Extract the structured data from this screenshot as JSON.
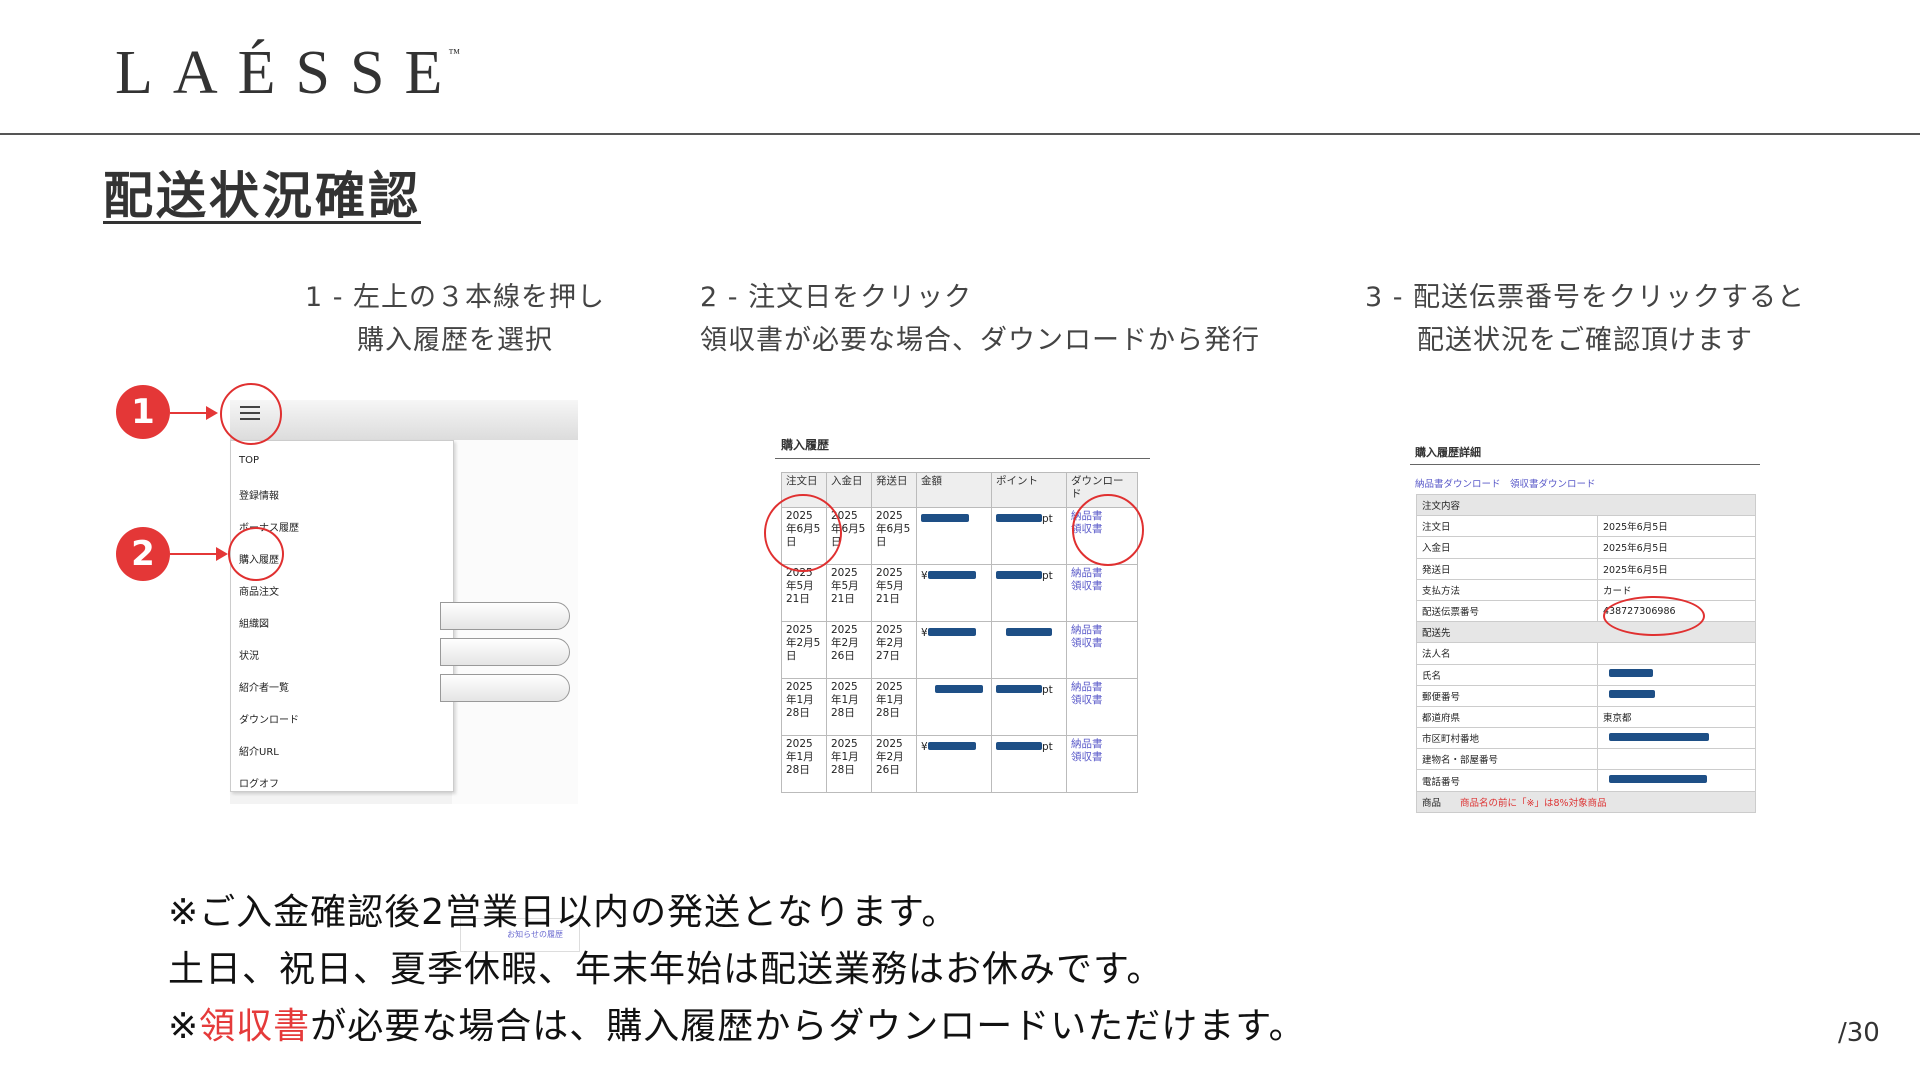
{
  "logo": {
    "brand": "LAÉSSE",
    "tm": "™"
  },
  "page_title": "配送状況確認",
  "steps": [
    {
      "line1": "1 - 左上の３本線を押し",
      "line2": "購入履歴を選択"
    },
    {
      "line1": "2 - 注文日をクリック",
      "line2": "領収書が必要な場合、ダウンロードから発行"
    },
    {
      "line1": "3 - 配送伝票番号をクリックすると",
      "line2": "配送状況をご確認頂けます"
    }
  ],
  "screen1": {
    "badges": [
      "1",
      "2"
    ],
    "menu_items": [
      "TOP",
      "登録情報",
      "ボーナス履歴",
      "購入履歴",
      "商品注文",
      "組織図",
      "状況",
      "紹介者一覧",
      "ダウンロード",
      "紹介URL",
      "ログオフ"
    ],
    "notice_link": "お知らせの履歴"
  },
  "screen2": {
    "title": "購入履歴",
    "headers": [
      "注文日",
      "入金日",
      "発送日",
      "金額",
      "ポイント",
      "ダウンロード"
    ],
    "rows": [
      {
        "order": "2025年6月5日",
        "paid": "2025年6月5日",
        "ship": "2025年6月5日",
        "amount_prefix": "",
        "point_suffix": "pt"
      },
      {
        "order": "2025年5月21日",
        "paid": "2025年5月21日",
        "ship": "2025年5月21日",
        "amount_prefix": "¥",
        "point_suffix": "pt"
      },
      {
        "order": "2025年2月5日",
        "paid": "2025年2月26日",
        "ship": "2025年2月27日",
        "amount_prefix": "¥",
        "point_suffix": ""
      },
      {
        "order": "2025年1月28日",
        "paid": "2025年1月28日",
        "ship": "2025年1月28日",
        "amount_prefix": "",
        "point_suffix": "pt"
      },
      {
        "order": "2025年1月28日",
        "paid": "2025年1月28日",
        "ship": "2025年2月26日",
        "amount_prefix": "¥",
        "point_suffix": "pt"
      }
    ],
    "dl_invoice": "納品書",
    "dl_receipt": "領収書"
  },
  "screen3": {
    "title": "購入履歴詳細",
    "links": "納品書ダウンロード　領収書ダウンロード",
    "section_order": "注文内容",
    "order_rows": [
      {
        "k": "注文日",
        "v": "2025年6月5日"
      },
      {
        "k": "入金日",
        "v": "2025年6月5日"
      },
      {
        "k": "発送日",
        "v": "2025年6月5日"
      },
      {
        "k": "支払方法",
        "v": "カード"
      },
      {
        "k": "配送伝票番号",
        "v": "438727306986"
      }
    ],
    "section_ship": "配送先",
    "ship_rows": [
      {
        "k": "法人名",
        "v": ""
      },
      {
        "k": "氏名",
        "v": ""
      },
      {
        "k": "郵便番号",
        "v": ""
      },
      {
        "k": "都道府県",
        "v": "東京都"
      },
      {
        "k": "市区町村番地",
        "v": ""
      },
      {
        "k": "建物名・部屋番号",
        "v": ""
      },
      {
        "k": "電話番号",
        "v": ""
      }
    ],
    "product_label": "商品",
    "product_note": "商品名の前に「※」は8%対象商品"
  },
  "notes": {
    "line1": "※ご入金確認後2営業日以内の発送となります。",
    "line2": "土日、祝日、夏季休暇、年末年始は配送業務はお休みです。",
    "line3_prefix": "※",
    "line3_red": "領収書",
    "line3_rest": "が必要な場合は、購入履歴からダウンロードいただけます。"
  },
  "page_number": "/30",
  "colors": {
    "accent_red": "#e43737",
    "link": "#5959c9",
    "redaction": "#1e4f86"
  }
}
